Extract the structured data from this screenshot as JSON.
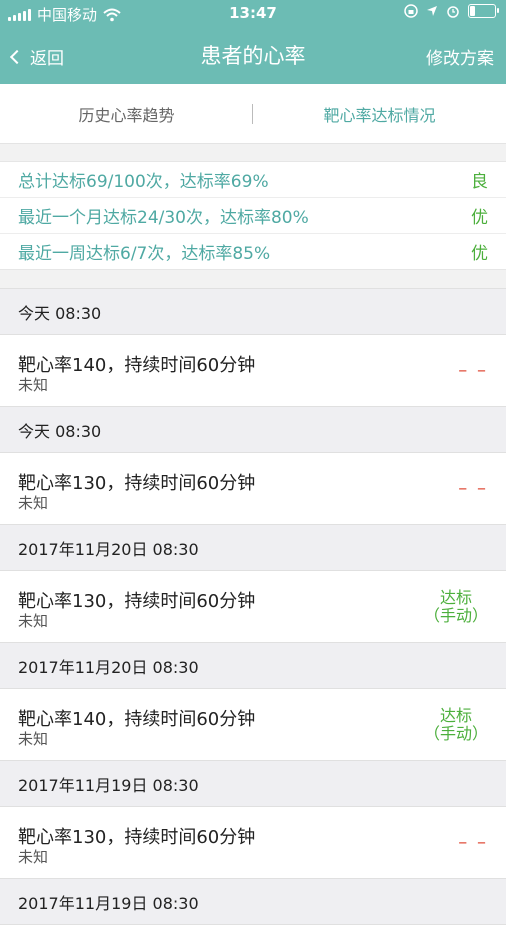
{
  "status_bar": {
    "carrier": "中国移动",
    "time": "13:47"
  },
  "nav": {
    "back_label": "返回",
    "title": "患者的心率",
    "right_label": "修改方案"
  },
  "tabs": [
    {
      "label": "历史心率趋势",
      "active": false
    },
    {
      "label": "靶心率达标情况",
      "active": true
    }
  ],
  "summary": [
    {
      "text": "总计达标69/100次，达标率69%",
      "grade": "良"
    },
    {
      "text": "最近一个月达标24/30次，达标率80%",
      "grade": "优"
    },
    {
      "text": "最近一周达标6/7次，达标率85%",
      "grade": "优"
    }
  ],
  "records": [
    {
      "date": "今天 08:30",
      "main": "靶心率140，持续时间60分钟",
      "sub": "未知",
      "status_line1": "– –",
      "status_line2": "",
      "status_type": "dash"
    },
    {
      "date": "今天 08:30",
      "main": "靶心率130，持续时间60分钟",
      "sub": "未知",
      "status_line1": "– –",
      "status_line2": "",
      "status_type": "dash"
    },
    {
      "date": "2017年11月20日 08:30",
      "main": "靶心率130，持续时间60分钟",
      "sub": "未知",
      "status_line1": "达标",
      "status_line2": "（手动）",
      "status_type": "ok"
    },
    {
      "date": "2017年11月20日 08:30",
      "main": "靶心率140，持续时间60分钟",
      "sub": "未知",
      "status_line1": "达标",
      "status_line2": "（手动）",
      "status_type": "ok"
    },
    {
      "date": "2017年11月19日 08:30",
      "main": "靶心率130，持续时间60分钟",
      "sub": "未知",
      "status_line1": "– –",
      "status_line2": "",
      "status_type": "dash"
    }
  ],
  "trailing_date": "2017年11月19日 08:30",
  "colors": {
    "header_bg": "#6cbcb4",
    "accent": "#4fa9a3",
    "ok": "#4caf3c",
    "dash": "#e0503c"
  }
}
